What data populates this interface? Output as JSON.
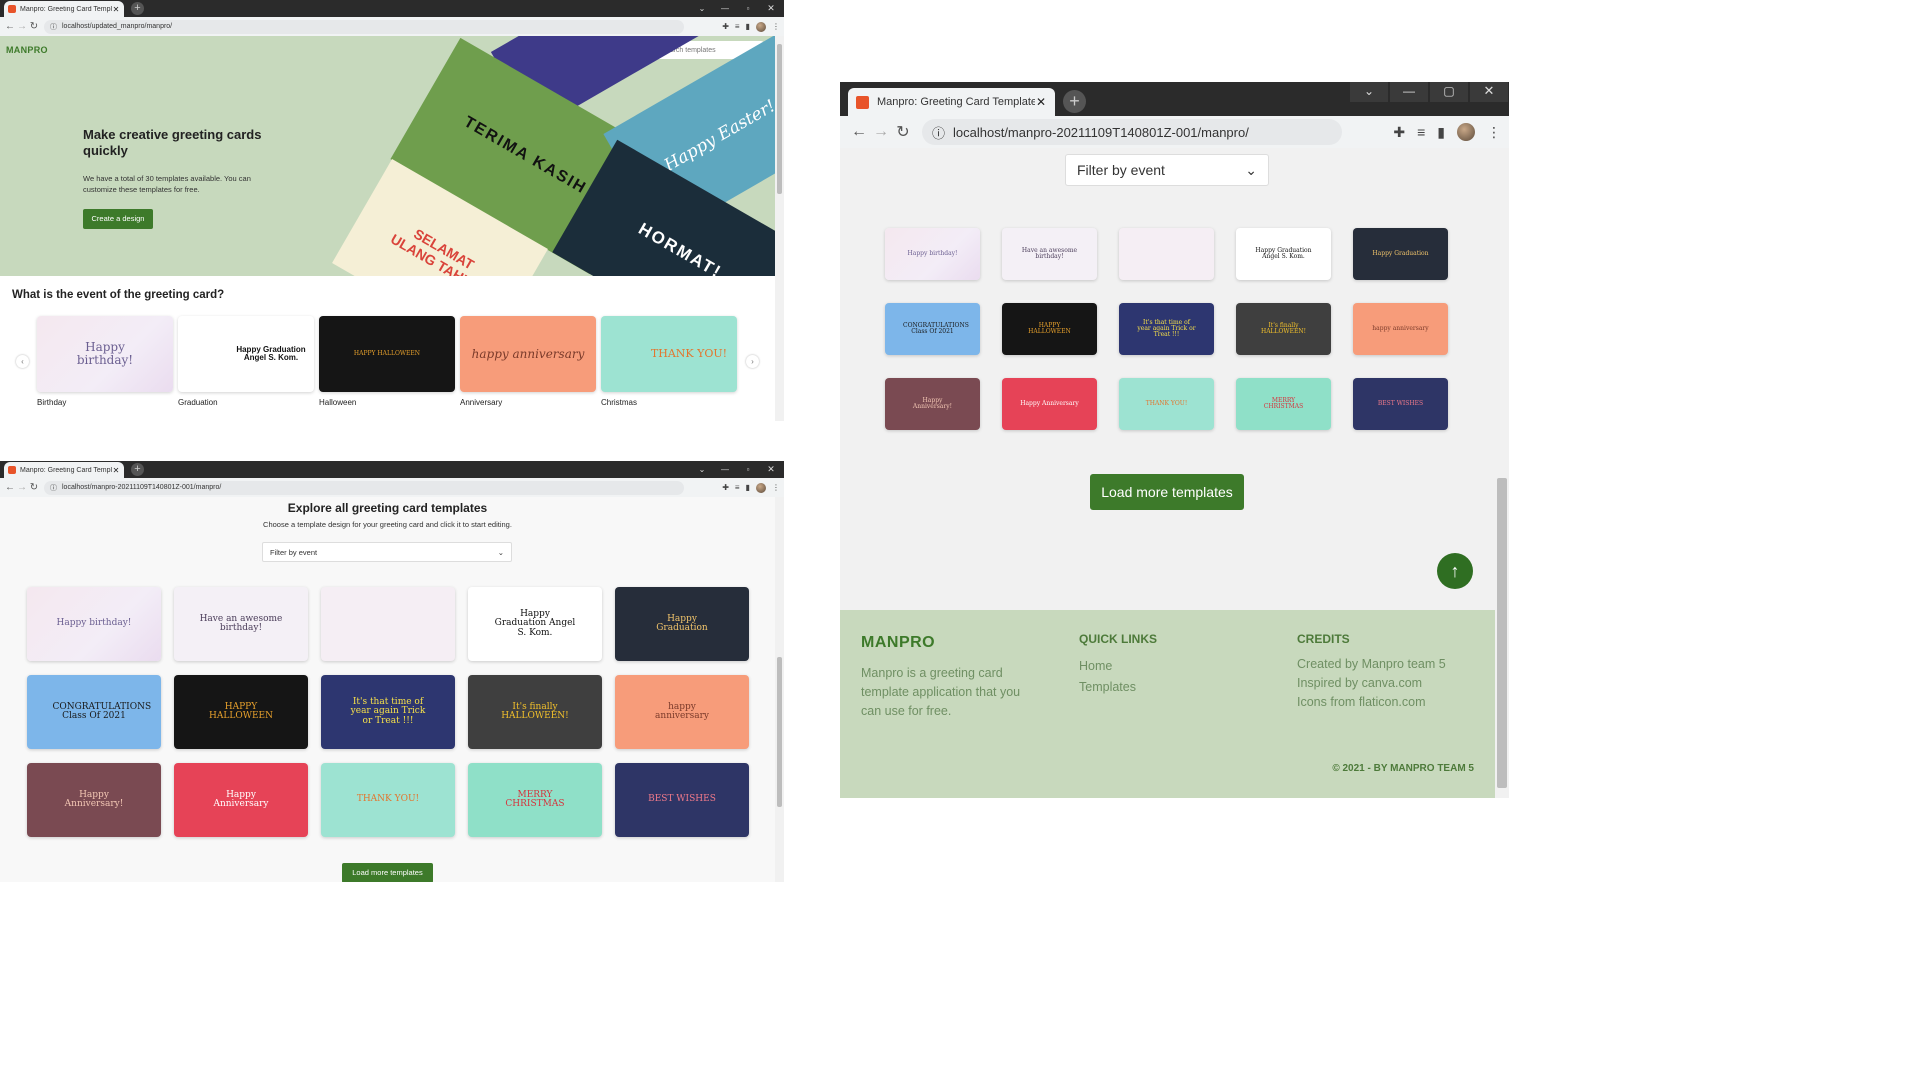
{
  "browser": {
    "tab_title": "Manpro: Greeting Card Template",
    "tab_title_short": "Manpro: Greeting Card Template",
    "url_top": "localhost/updated_manpro/manpro/",
    "url_other": "localhost/manpro-20211109T140801Z-001/manpro/"
  },
  "brand": {
    "logo": "MANPRO"
  },
  "search": {
    "placeholder": "Search templates"
  },
  "hero": {
    "title": "Make creative greeting cards quickly",
    "desc": "We have a total of 30 templates available. You can customize these templates for free.",
    "cta": "Create a design",
    "collage": [
      "Terima kasih",
      "Happy Easter!",
      "Selamat ulang tahun",
      "Hormat!"
    ]
  },
  "events": {
    "heading": "What is the event of the greeting card?",
    "items": [
      {
        "label": "Birthday",
        "card": "Happy birthday!"
      },
      {
        "label": "Graduation",
        "card": "Happy Graduation Angel S. Kom."
      },
      {
        "label": "Halloween",
        "card": "HAPPY HALLOWEEN"
      },
      {
        "label": "Anniversary",
        "card": "happy anniversary"
      },
      {
        "label": "Christmas",
        "card": "THANK YOU!"
      }
    ]
  },
  "explore": {
    "title": "Explore all greeting card templates",
    "subtitle": "Choose a template design for your greeting card and click it to start editing.",
    "filter": "Filter by event",
    "load_more": "Load more templates"
  },
  "templates": [
    {
      "cls": "bg-bday",
      "text": "Happy birthday!"
    },
    {
      "cls": "bg-awe",
      "text": "Have an awesome birthday!"
    },
    {
      "cls": "bg-bday2",
      "text": ""
    },
    {
      "cls": "bg-grad",
      "text": "Happy Graduation Angel S. Kom."
    },
    {
      "cls": "bg-grad2",
      "text": "Happy Graduation"
    },
    {
      "cls": "bg-congr",
      "text": "CONGRATULATIONS Class Of 2021"
    },
    {
      "cls": "bg-hal",
      "text": "HAPPY HALLOWEEN"
    },
    {
      "cls": "bg-trick",
      "text": "It's that time of year again Trick or Treat !!!"
    },
    {
      "cls": "bg-hal2",
      "text": "It's finally HALLOWEEN!"
    },
    {
      "cls": "bg-anni",
      "text": "happy anniversary"
    },
    {
      "cls": "bg-anni2",
      "text": "Happy Anniversary!"
    },
    {
      "cls": "bg-anni3",
      "text": "Happy Anniversary"
    },
    {
      "cls": "bg-thank",
      "text": "THANK YOU!"
    },
    {
      "cls": "bg-xmas",
      "text": "MERRY CHRISTMAS"
    },
    {
      "cls": "bg-best",
      "text": "BEST WISHES"
    }
  ],
  "footer": {
    "logo": "MANPRO",
    "about": "Manpro is a greeting card template application that you can use for free.",
    "quick_links_title": "QUICK LINKS",
    "links": [
      "Home",
      "Templates"
    ],
    "credits_title": "CREDITS",
    "credits": [
      "Created by Manpro team 5",
      "Inspired by canva.com",
      "Icons from flaticon.com"
    ],
    "copyright": "© 2021 - BY MANPRO TEAM 5"
  },
  "colors": {
    "green": "#3d7a2a",
    "hero_bg": "#c7d9bd",
    "footer_bg": "#c8d9bd"
  }
}
